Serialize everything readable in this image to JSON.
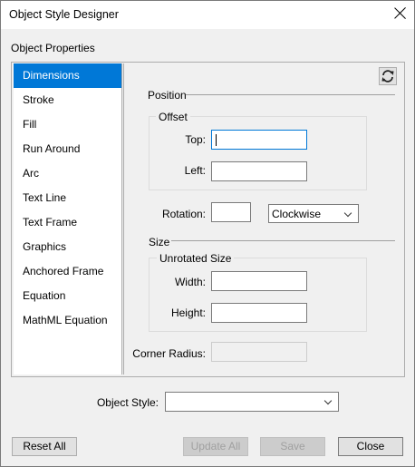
{
  "window": {
    "title": "Object Style Designer"
  },
  "group_label": "Object Properties",
  "sidebar": {
    "items": [
      {
        "label": "Dimensions",
        "selected": true
      },
      {
        "label": "Stroke"
      },
      {
        "label": "Fill"
      },
      {
        "label": "Run Around"
      },
      {
        "label": "Arc"
      },
      {
        "label": "Text Line"
      },
      {
        "label": "Text Frame"
      },
      {
        "label": "Graphics"
      },
      {
        "label": "Anchored Frame"
      },
      {
        "label": "Equation"
      },
      {
        "label": "MathML Equation"
      }
    ]
  },
  "position": {
    "label": "Position",
    "offset": {
      "label": "Offset",
      "top_label": "Top:",
      "top_value": "",
      "left_label": "Left:",
      "left_value": ""
    },
    "rotation_label": "Rotation:",
    "rotation_value": "",
    "direction": "Clockwise"
  },
  "size": {
    "label": "Size",
    "unrotated": {
      "label": "Unrotated Size",
      "width_label": "Width:",
      "width_value": "",
      "height_label": "Height:",
      "height_value": ""
    },
    "corner_radius_label": "Corner Radius:",
    "corner_radius_value": ""
  },
  "object_style": {
    "label": "Object Style:",
    "value": ""
  },
  "buttons": {
    "reset_all": "Reset All",
    "update_all": "Update All",
    "save": "Save",
    "close": "Close"
  },
  "icons": {
    "refresh": "refresh-icon",
    "close": "close-icon",
    "dropdown": "chevron-down-icon"
  },
  "colors": {
    "selection": "#0078d7"
  }
}
